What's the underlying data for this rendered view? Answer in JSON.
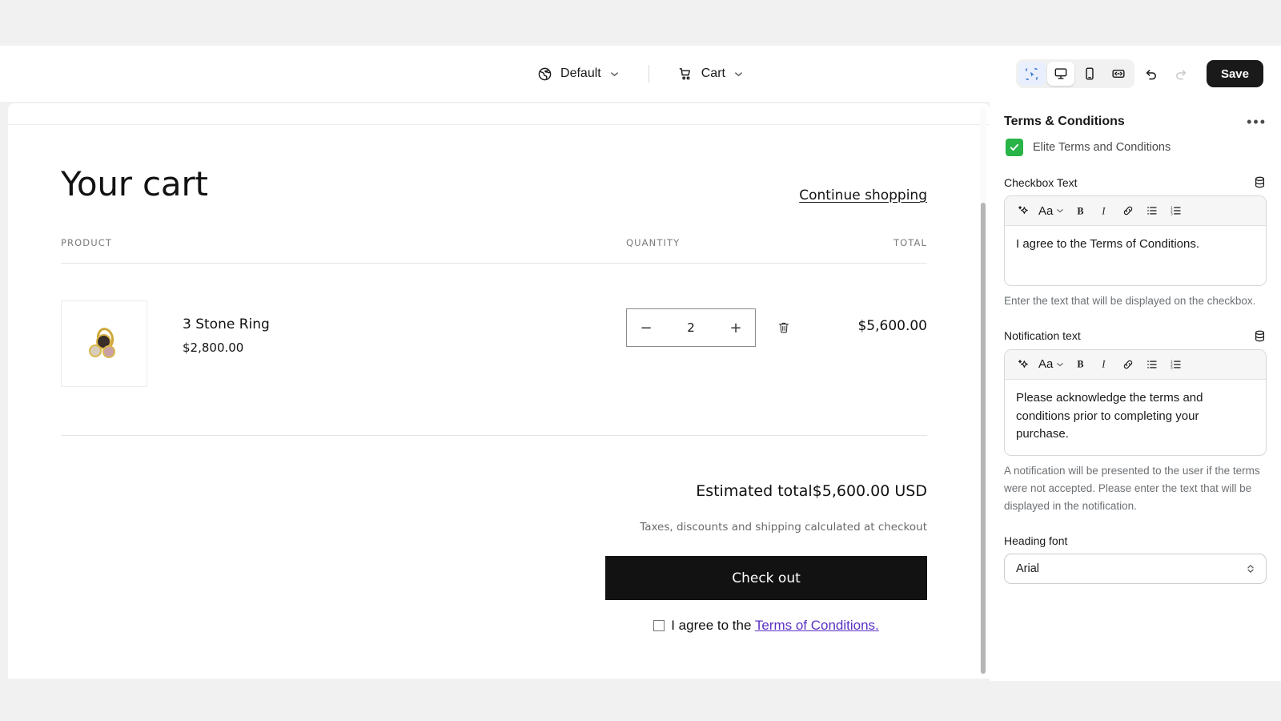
{
  "topbar": {
    "theme_label": "Default",
    "page_label": "Cart",
    "save_label": "Save",
    "tools": [
      {
        "name": "select-tool",
        "active": true
      },
      {
        "name": "desktop-view",
        "active": true
      },
      {
        "name": "mobile-view",
        "active": false
      },
      {
        "name": "fullscreen-view",
        "active": false
      }
    ],
    "undo_label": "Undo",
    "redo_label": "Redo"
  },
  "cart": {
    "title": "Your cart",
    "continue_link": "Continue shopping",
    "columns": {
      "product": "PRODUCT",
      "quantity": "QUANTITY",
      "total": "TOTAL"
    },
    "items": [
      {
        "name": "3 Stone Ring",
        "price": "$2,800.00",
        "quantity": "2",
        "total": "$5,600.00",
        "decrement": "−",
        "increment": "+"
      }
    ],
    "estimated_total_label": "Estimated total",
    "estimated_total_value": "$5,600.00 USD",
    "tax_note": "Taxes, discounts and shipping calculated at checkout",
    "checkout_label": "Check out",
    "agree_prefix": "I agree to the ",
    "agree_link": "Terms of Conditions.",
    "agree_checked": false,
    "link_color": "#5a31c4"
  },
  "sidebar": {
    "title": "Terms & Conditions",
    "menu_label": "•••",
    "block": {
      "label": "Elite Terms and Conditions",
      "checked": true,
      "check_color": "#28b446"
    },
    "fields": [
      {
        "label": "Checkbox Text",
        "value": "I agree to the Terms of Conditions.",
        "help": "Enter the text that will be displayed on the checkbox."
      },
      {
        "label": "Notification text",
        "value": "Please acknowledge the terms and conditions prior to completing your purchase.",
        "help": "A notification will be presented to the user if the terms were not accepted. Please enter the text that will be displayed in the notification."
      }
    ],
    "editor_toolbar": {
      "ai_label": "AI",
      "font_label": "Aa",
      "bold_label": "B",
      "italic_label": "I",
      "link_label": "Link",
      "bullet_label": "Bulleted list",
      "numbered_label": "Numbered list"
    },
    "heading_font": {
      "label": "Heading font",
      "value": "Arial"
    }
  }
}
